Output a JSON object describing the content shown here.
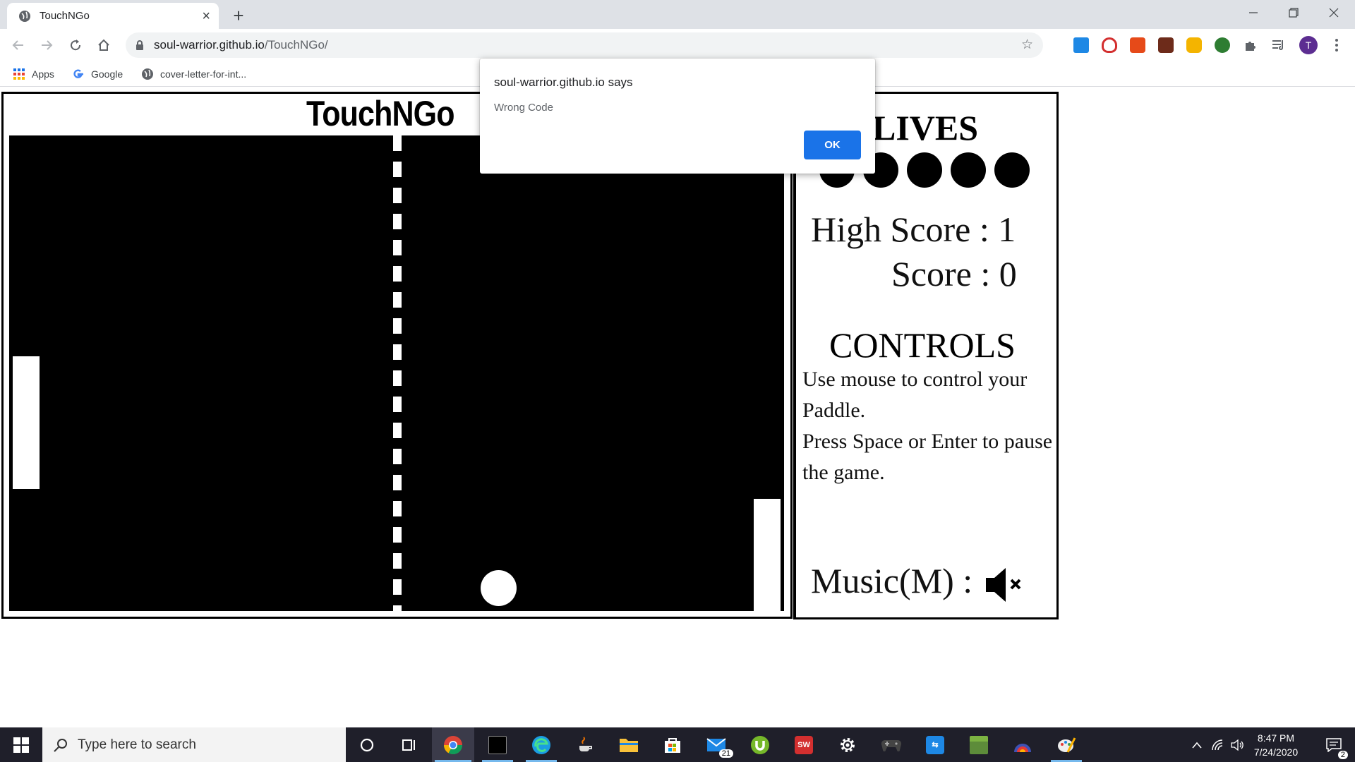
{
  "browser": {
    "tab": {
      "title": "TouchNGo",
      "close_glyph": "×"
    },
    "new_tab_glyph": "+",
    "url": {
      "host": "soul-warrior.github.io",
      "path": "/TouchNGo/"
    },
    "avatar_letter": "T",
    "bookmarks": [
      {
        "label": "Apps",
        "icon": "apps-grid-icon"
      },
      {
        "label": "Google",
        "icon": "google-icon"
      },
      {
        "label": "cover-letter-for-int...",
        "icon": "globe-icon"
      }
    ],
    "extension_icons": [
      "extension-1-icon",
      "extension-2-icon",
      "extension-3-icon",
      "extension-4-icon",
      "extension-5-icon",
      "extension-6-icon",
      "puzzle-icon",
      "media-control-icon"
    ]
  },
  "dialog": {
    "title": "soul-warrior.github.io says",
    "message": "Wrong Code",
    "ok_label": "OK"
  },
  "game": {
    "title": "TouchNGo",
    "lives_label": "LIVES",
    "lives_count": 5,
    "high_score_text": "High Score : 1",
    "score_text": "Score : 0",
    "controls_title": "CONTROLS",
    "controls_lines": [
      "Use mouse to control your Paddle.",
      "Press Space or Enter to pause the game."
    ],
    "music_label": "Music(M) :",
    "music_state": "muted"
  },
  "taskbar": {
    "search_placeholder": "Type here to search",
    "mail_badge": "21",
    "clock_time": "8:47 PM",
    "clock_date": "7/24/2020",
    "notification_badge": "2",
    "apps": [
      "cortana-icon",
      "task-view-icon",
      "chrome-icon",
      "terminal-icon",
      "edge-icon",
      "java-icon",
      "file-explorer-icon",
      "store-icon",
      "mail-icon",
      "utorrent-icon",
      "solidworks-icon",
      "settings-icon",
      "gamepad-icon",
      "share-app-icon",
      "minecraft-icon",
      "flag-app-icon",
      "paint-icon"
    ]
  }
}
